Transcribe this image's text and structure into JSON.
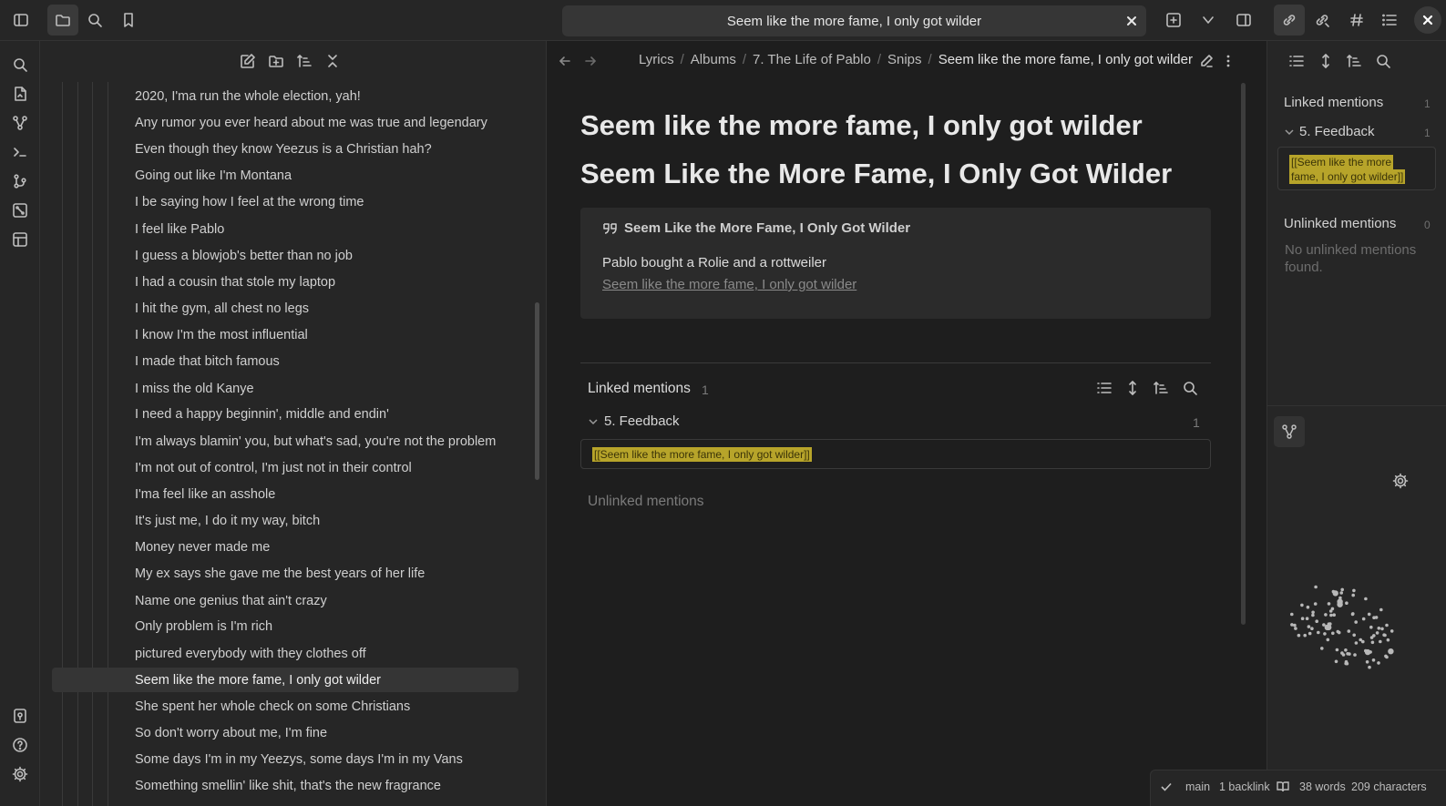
{
  "tab": {
    "title": "Seem like the more fame, I only got wilder"
  },
  "breadcrumb": [
    "Lyrics",
    "Albums",
    "7. The Life of Pablo",
    "Snips",
    "Seem like the more fame, I only got wilder"
  ],
  "files": [
    "2020, I'ma run the whole election, yah!",
    "Any rumor you ever heard about me was true and legendary",
    "Even though they know Yeezus is a Christian hah?",
    "Going out like I'm Montana",
    "I be saying how I feel at the wrong time",
    "I feel like Pablo",
    "I guess a blowjob's better than no job",
    "I had a cousin that stole my laptop",
    "I hit the gym, all chest no legs",
    "I know I'm the most influential",
    "I made that bitch famous",
    "I miss the old Kanye",
    "I need a happy beginnin', middle and endin'",
    "I'm always blamin' you, but what's sad, you're not the problem",
    "I'm not out of control, I'm just not in their control",
    "I'ma feel like an asshole",
    "It's just me, I do it my way, bitch",
    "Money never made me",
    "My ex says she gave me the best years of her life",
    "Name one genius that ain't crazy",
    "Only problem is I'm rich",
    "pictured everybody with they clothes off",
    "Seem like the more fame, I only got wilder",
    "She spent her whole check on some Christians",
    "So don't worry about me, I'm fine",
    "Some days I'm in my Yeezys, some days I'm in my Vans",
    "Something smellin' like shit, that's the new fragrance"
  ],
  "active_file_index": 22,
  "note": {
    "heading1": "Seem like the more fame, I only got wilder",
    "heading2": "Seem Like the More Fame, I Only Got Wilder",
    "callout_title": "Seem Like the More Fame, I Only Got Wilder",
    "callout_body": "Pablo bought a Rolie and a rottweiler",
    "callout_link": "Seem like the more fame, I only got wilder"
  },
  "backlinks": {
    "linked_title": "Linked mentions",
    "linked_count": "1",
    "group_name": "5. Feedback",
    "group_count": "1",
    "mention_text": "[[Seem like the more fame, I only got wilder]]",
    "unlinked_title": "Unlinked mentions"
  },
  "right_panel": {
    "linked_title": "Linked mentions",
    "linked_count": "1",
    "group_name": "5. Feedback",
    "group_count": "1",
    "mention_line1": "[[Seem like the more",
    "mention_line2": "fame, I only got wilder]]",
    "unlinked_title": "Unlinked mentions",
    "unlinked_count": "0",
    "empty_text": "No unlinked mentions found."
  },
  "status": {
    "branch": "main",
    "backlinks": "1 backlink",
    "words": "38 words",
    "characters": "209 characters"
  },
  "colors": {
    "highlight": "#b7a42a",
    "background": "#1e1e1e",
    "panel": "#262626"
  }
}
